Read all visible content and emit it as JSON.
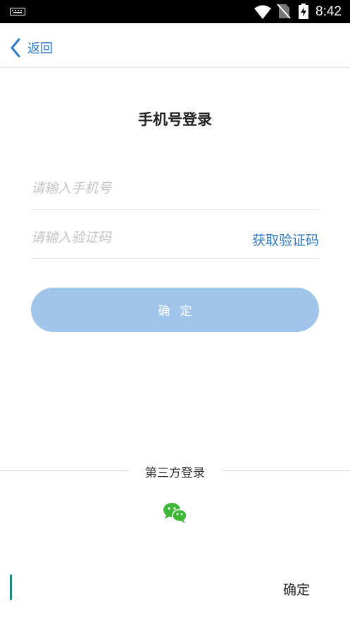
{
  "status_bar": {
    "time": "8:42",
    "icons": [
      "keyboard-icon",
      "wifi-icon",
      "no-sim-icon",
      "battery-charging-icon"
    ]
  },
  "nav": {
    "back_label": "返回",
    "back_icon": "chevron-left-icon"
  },
  "title": "手机号登录",
  "form": {
    "phone_placeholder": "请输入手机号",
    "phone_value": "",
    "code_placeholder": "请输入验证码",
    "code_value": "",
    "get_code_label": "获取验证码",
    "confirm_label": "确定"
  },
  "third_party": {
    "label": "第三方登录",
    "icons": [
      "wechat-icon"
    ]
  },
  "bottom": {
    "confirm_label": "确定"
  },
  "colors": {
    "accent": "#2d79c6",
    "button": "#a1c4ea",
    "wechat": "#3fb837",
    "caret": "#1a8a80"
  }
}
